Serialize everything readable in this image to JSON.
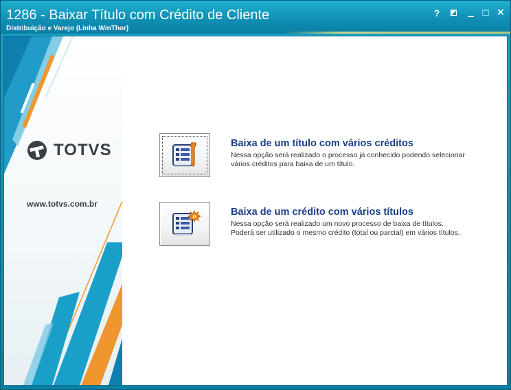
{
  "window": {
    "title": "1286 - Baixar Título com Crédito de Cliente",
    "subtitle": "Distribuição e Varejo (Linha WinThor)",
    "controls": {
      "help": "?",
      "close": "✕"
    },
    "colors": {
      "titlebar": "#0f8db3",
      "accent_orange": "#f0962e",
      "accent_blue": "#1a9fc9",
      "link_blue": "#1d3f8a"
    }
  },
  "sidebar": {
    "brand": "TOTVS",
    "website": "www.totvs.com.br"
  },
  "options": [
    {
      "title": "Baixa de um título com vários créditos",
      "description_lines": [
        "Nessa opção será realizado o processo já conhecido podendo selecionar",
        "vários créditos para baixa de um título."
      ],
      "icon": "document-wrench-icon"
    },
    {
      "title": "Baixa de um crédito com vários títulos",
      "description_lines": [
        "Nessa opção será realizado um novo processo de baixa de títulos.",
        "Poderá ser utilizado o mesmo crédito (total ou parcial) em vários títulos."
      ],
      "icon": "document-new-badge-icon",
      "badge": "n"
    }
  ]
}
